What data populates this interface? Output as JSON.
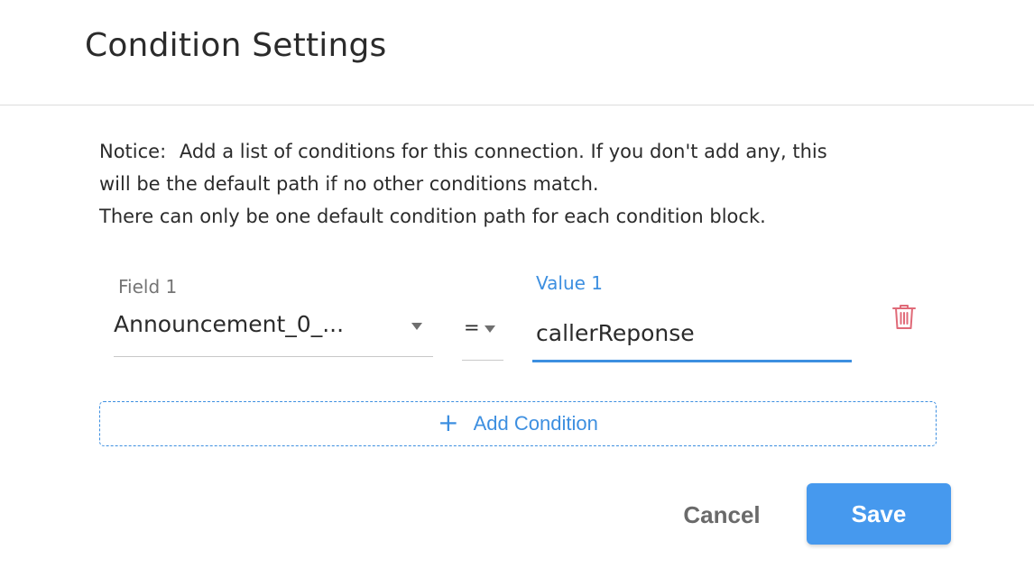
{
  "dialog": {
    "title": "Condition Settings"
  },
  "notice": {
    "prefix": "Notice:",
    "line1": "Add a list of conditions for this connection. If you don't add any, this",
    "line2": "will be the default path if no other conditions match.",
    "line3": "There can only be one default condition path for each condition block."
  },
  "conditions": [
    {
      "field_label": "Field 1",
      "field_value": "Announcement_0_...",
      "operator": "=",
      "value_label": "Value 1",
      "value": "callerReponse"
    }
  ],
  "actions": {
    "add_condition": "Add Condition",
    "cancel": "Cancel",
    "save": "Save"
  },
  "icons": {
    "delete": "trash-icon",
    "add": "plus-icon",
    "dropdown": "chevron-down-icon"
  },
  "colors": {
    "accent": "#3d8fe0",
    "save_button": "#4699ee",
    "delete_icon": "#e06a78",
    "text": "#2b2b2b",
    "muted_text": "#757575"
  }
}
